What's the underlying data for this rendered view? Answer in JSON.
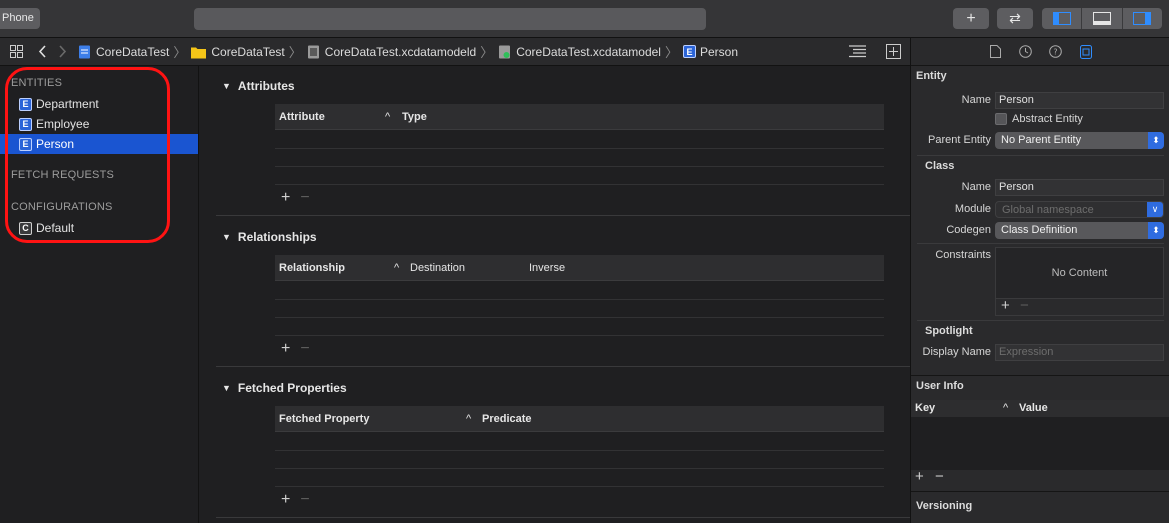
{
  "toolbar": {
    "scheme_label": "Phone",
    "add_label": "+",
    "swap_label": "⇄"
  },
  "jumpbar": {
    "crumbs": [
      {
        "label": "CoreDataTest",
        "icon": "swift-project-icon"
      },
      {
        "label": "CoreDataTest",
        "icon": "folder-icon"
      },
      {
        "label": "CoreDataTest.xcdatamodeld",
        "icon": "model-bundle-icon"
      },
      {
        "label": "CoreDataTest.xcdatamodel",
        "icon": "model-file-icon"
      },
      {
        "label": "Person",
        "icon": "entity-icon"
      }
    ]
  },
  "outline": {
    "entities_header": "ENTITIES",
    "entities": [
      {
        "badge": "E",
        "label": "Department"
      },
      {
        "badge": "E",
        "label": "Employee"
      },
      {
        "badge": "E",
        "label": "Person",
        "selected": true
      }
    ],
    "fetch_requests_header": "FETCH REQUESTS",
    "configurations_header": "CONFIGURATIONS",
    "configurations": [
      {
        "badge": "C",
        "label": "Default"
      }
    ],
    "annotation_color": "#ff1313"
  },
  "editor": {
    "attributes": {
      "title": "Attributes",
      "columns": [
        "Attribute",
        "Type"
      ],
      "sort_indicator": "^"
    },
    "relationships": {
      "title": "Relationships",
      "columns": [
        "Relationship",
        "Destination",
        "Inverse"
      ],
      "sort_indicator": "^"
    },
    "fetched_properties": {
      "title": "Fetched Properties",
      "columns": [
        "Fetched Property",
        "Predicate"
      ],
      "sort_indicator": "^"
    },
    "add_label": "+",
    "remove_label": "−"
  },
  "inspector": {
    "entity_header": "Entity",
    "name_label": "Name",
    "entity_name": "Person",
    "abstract_label": "Abstract Entity",
    "parent_label": "Parent Entity",
    "parent_value": "No Parent Entity",
    "class_header": "Class",
    "class_name_label": "Name",
    "class_name": "Person",
    "module_label": "Module",
    "module_placeholder": "Global namespace",
    "codegen_label": "Codegen",
    "codegen_value": "Class Definition",
    "constraints_label": "Constraints",
    "no_content": "No Content",
    "spotlight_header": "Spotlight",
    "display_name_label": "Display Name",
    "display_name_placeholder": "Expression",
    "user_info_header": "User Info",
    "user_info_columns": [
      "Key",
      "Value"
    ],
    "versioning_header": "Versioning",
    "accent_color": "#2f6ce0"
  }
}
